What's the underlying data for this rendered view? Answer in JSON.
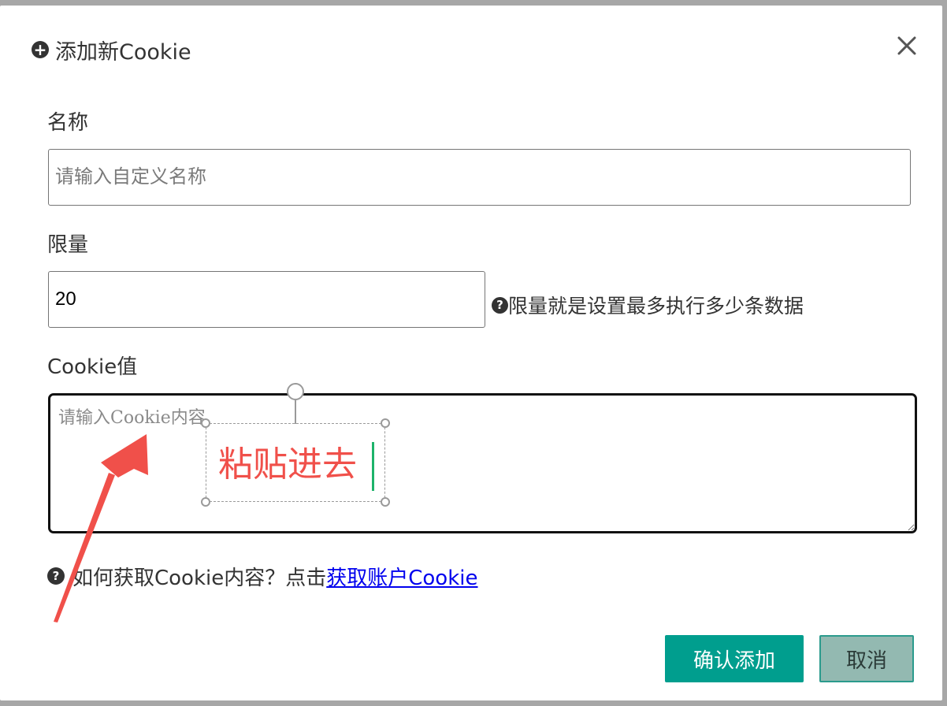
{
  "dialog": {
    "title": "添加新Cookie",
    "close_icon": "close-icon"
  },
  "fields": {
    "name": {
      "label": "名称",
      "value": "",
      "placeholder": "请输入自定义名称"
    },
    "limit": {
      "label": "限量",
      "value": "20",
      "hint": "限量就是设置最多执行多少条数据"
    },
    "cookie": {
      "label": "Cookie值",
      "value": "",
      "placeholder": "请输入Cookie内容"
    }
  },
  "annotation": {
    "text": "粘贴进去",
    "color": "#f0504a"
  },
  "help": {
    "text": "如何获取Cookie内容？点击",
    "link": "获取账户Cookie"
  },
  "buttons": {
    "confirm": "确认添加",
    "cancel": "取消"
  },
  "colors": {
    "primary": "#009e8e",
    "cancel_bg": "#93b9b1",
    "link": "#0000ee"
  }
}
